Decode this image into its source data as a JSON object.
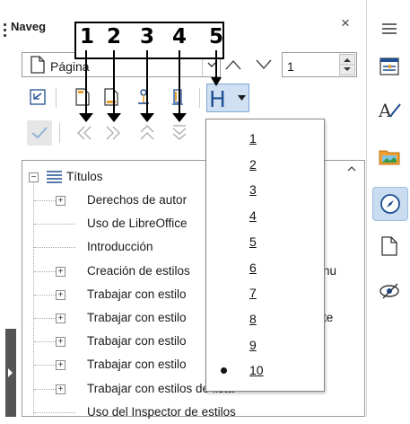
{
  "navigator": {
    "title": "Naveg",
    "close_glyph": "×",
    "type_select": {
      "value": "Página",
      "icon": "page-icon"
    },
    "page_number": "1",
    "tree": {
      "root_label": "Títulos",
      "items": [
        {
          "label": "Derechos de autor",
          "expandable": true
        },
        {
          "label": "Uso de LibreOffice",
          "expandable": false
        },
        {
          "label": "Introducción",
          "expandable": false
        },
        {
          "label": "Creación de estilos",
          "suffix": "nu",
          "expandable": true
        },
        {
          "label": "Trabajar con estilo",
          "expandable": true
        },
        {
          "label": "Trabajar con estilo",
          "suffix": "te",
          "expandable": true
        },
        {
          "label": "Trabajar con estilo",
          "expandable": true
        },
        {
          "label": "Trabajar con estilo",
          "expandable": true
        },
        {
          "label": "Trabajar con estilos de lista",
          "expandable": true
        },
        {
          "label": "Uso del Inspector de estilos",
          "expandable": false
        }
      ]
    }
  },
  "callout": {
    "numbers": [
      "1",
      "2",
      "3",
      "4",
      "5"
    ]
  },
  "heading_button": {
    "label": "H"
  },
  "heading_levels_menu": {
    "items": [
      "1",
      "2",
      "3",
      "4",
      "5",
      "6",
      "7",
      "8",
      "9",
      "10"
    ],
    "selected": "10"
  },
  "sidebar": {
    "buttons": [
      "hamburger-menu-icon",
      "properties-icon",
      "styles-icon",
      "gallery-icon",
      "navigator-icon",
      "page-icon",
      "style-inspector-icon"
    ],
    "active": "navigator-icon"
  },
  "colors": {
    "accent": "#1f4e92",
    "selected_bg": "#cfe0f3",
    "folder": "#f0a030"
  }
}
